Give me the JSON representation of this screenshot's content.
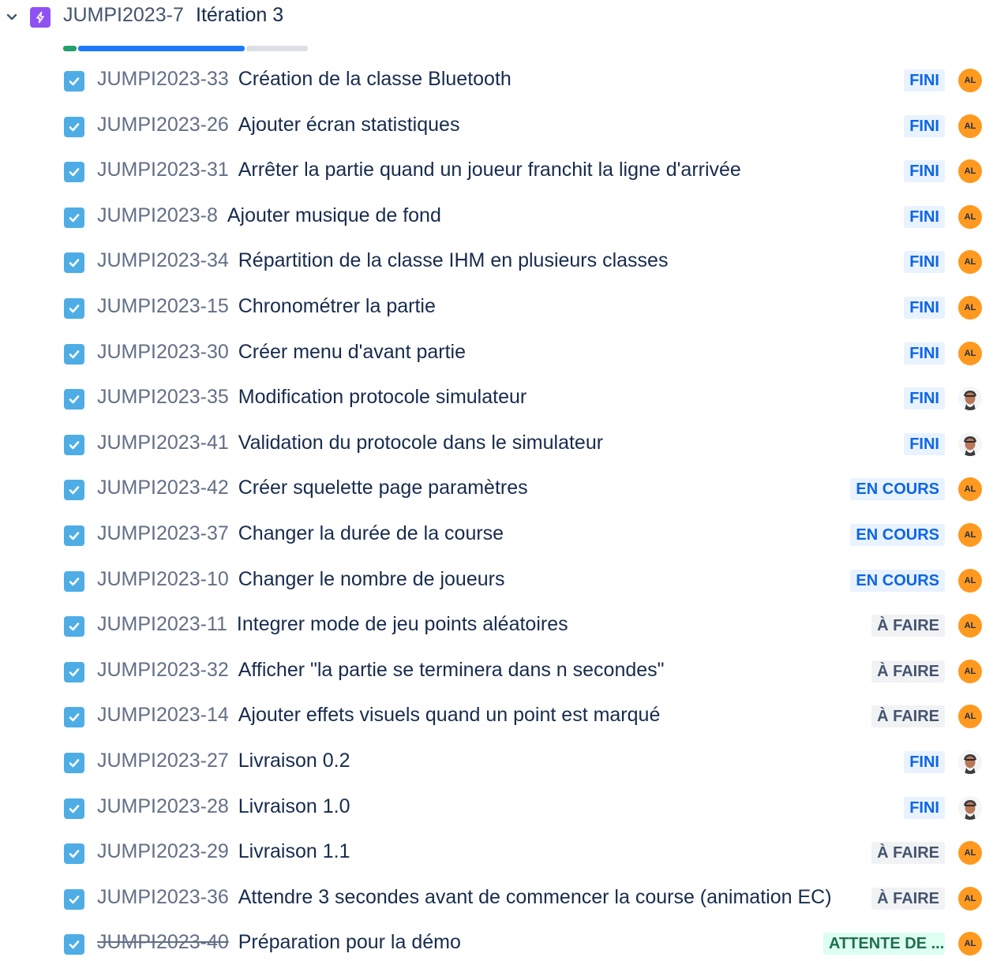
{
  "epic": {
    "key": "JUMPI2023-7",
    "title": "Itération 3",
    "expand_icon": "chevron-down-icon",
    "type_icon": "lightning-icon",
    "type_color": "#8f52f2",
    "progress": {
      "done": 0.055,
      "in_progress": 0.69,
      "todo": 0.255
    }
  },
  "colors": {
    "checkbox": "#4fade6",
    "avatar_al": "#ff991f",
    "status_done_bg": "#e9f2ff",
    "status_done_fg": "#0c66e4",
    "status_todo_bg": "#f1f2f4",
    "status_todo_fg": "#44546f",
    "status_wait_bg": "#dcfff1",
    "status_wait_fg": "#216e4e"
  },
  "issues": [
    {
      "key": "JUMPI2023-33",
      "summary": "Création de la classe Bluetooth",
      "status": "FINI",
      "status_type": "done",
      "assignee": "AL",
      "done": false
    },
    {
      "key": "JUMPI2023-26",
      "summary": "Ajouter écran statistiques",
      "status": "FINI",
      "status_type": "done",
      "assignee": "AL",
      "done": false
    },
    {
      "key": "JUMPI2023-31",
      "summary": "Arrêter la partie quand un joueur franchit la ligne d'arrivée",
      "status": "FINI",
      "status_type": "done",
      "assignee": "AL",
      "done": false
    },
    {
      "key": "JUMPI2023-8",
      "summary": "Ajouter musique de fond",
      "status": "FINI",
      "status_type": "done",
      "assignee": "AL",
      "done": false
    },
    {
      "key": "JUMPI2023-34",
      "summary": "Répartition de la classe IHM en plusieurs classes",
      "status": "FINI",
      "status_type": "done",
      "assignee": "AL",
      "done": false
    },
    {
      "key": "JUMPI2023-15",
      "summary": "Chronométrer la partie",
      "status": "FINI",
      "status_type": "done",
      "assignee": "AL",
      "done": false
    },
    {
      "key": "JUMPI2023-30",
      "summary": "Créer menu d'avant partie",
      "status": "FINI",
      "status_type": "done",
      "assignee": "AL",
      "done": false
    },
    {
      "key": "JUMPI2023-35",
      "summary": "Modification protocole simulateur",
      "status": "FINI",
      "status_type": "done",
      "assignee": "photo",
      "done": false
    },
    {
      "key": "JUMPI2023-41",
      "summary": "Validation du protocole dans le simulateur",
      "status": "FINI",
      "status_type": "done",
      "assignee": "photo",
      "done": false
    },
    {
      "key": "JUMPI2023-42",
      "summary": "Créer squelette page paramètres",
      "status": "EN COURS",
      "status_type": "inprog",
      "assignee": "AL",
      "done": false
    },
    {
      "key": "JUMPI2023-37",
      "summary": "Changer la durée de la course",
      "status": "EN COURS",
      "status_type": "inprog",
      "assignee": "AL",
      "done": false
    },
    {
      "key": "JUMPI2023-10",
      "summary": "Changer le nombre de joueurs",
      "status": "EN COURS",
      "status_type": "inprog",
      "assignee": "AL",
      "done": false
    },
    {
      "key": "JUMPI2023-11",
      "summary": "Integrer mode de jeu points aléatoires",
      "status": "À FAIRE",
      "status_type": "todo",
      "assignee": "AL",
      "done": false
    },
    {
      "key": "JUMPI2023-32",
      "summary": "Afficher \"la partie se terminera dans n secondes\"",
      "status": "À FAIRE",
      "status_type": "todo",
      "assignee": "AL",
      "done": false
    },
    {
      "key": "JUMPI2023-14",
      "summary": "Ajouter effets visuels quand un point est marqué",
      "status": "À FAIRE",
      "status_type": "todo",
      "assignee": "AL",
      "done": false
    },
    {
      "key": "JUMPI2023-27",
      "summary": "Livraison 0.2",
      "status": "FINI",
      "status_type": "done",
      "assignee": "photo",
      "done": false
    },
    {
      "key": "JUMPI2023-28",
      "summary": "Livraison 1.0",
      "status": "FINI",
      "status_type": "done",
      "assignee": "photo",
      "done": false
    },
    {
      "key": "JUMPI2023-29",
      "summary": "Livraison 1.1",
      "status": "À FAIRE",
      "status_type": "todo",
      "assignee": "AL",
      "done": false
    },
    {
      "key": "JUMPI2023-36",
      "summary": "Attendre 3 secondes avant de commencer la course (animation EC)",
      "status": "À FAIRE",
      "status_type": "todo",
      "assignee": "AL",
      "done": false
    },
    {
      "key": "JUMPI2023-40",
      "summary": "Préparation pour la démo",
      "status": "ATTENTE DE ...",
      "status_type": "wait",
      "assignee": "AL",
      "done": true
    }
  ]
}
